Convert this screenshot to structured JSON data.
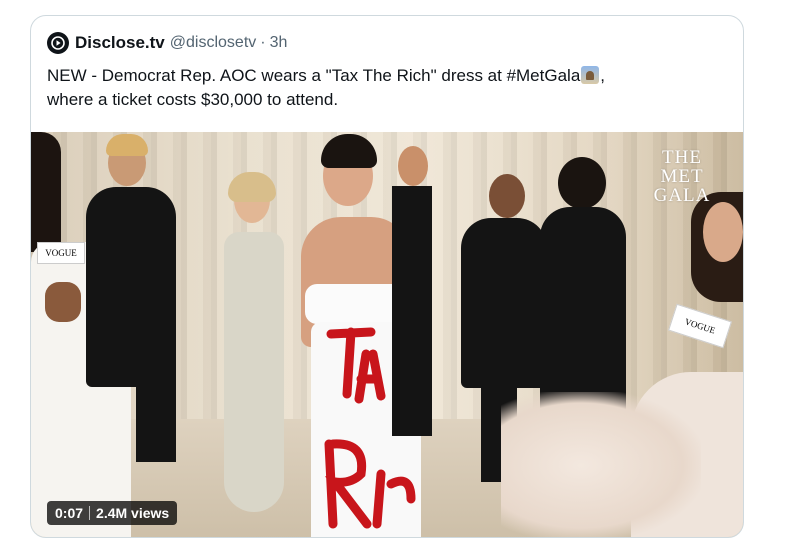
{
  "tweet": {
    "author_name": "Disclose.tv",
    "handle": "@disclosetv",
    "separator": "·",
    "timestamp": "3h",
    "text": "NEW - Democrat Rep. AOC wears a \"Tax The Rich\" dress at #MetGala",
    "text_line2": ",",
    "text_second_line": "where a ticket costs $30,000 to attend.",
    "emoji_icon": "city-scene-emoji"
  },
  "media": {
    "overlay_logo_lines": [
      "THE",
      "MET",
      "GALA"
    ],
    "mic_flag_left": "VOGUE",
    "mic_flag_right": "VOGUE",
    "dress_text": "TAX THE RICH",
    "video_time": "0:07",
    "video_views": "2.4M views"
  },
  "colors": {
    "text_primary": "#0f1419",
    "text_secondary": "#536471",
    "card_border": "#cfd9de",
    "dress_red": "#c8151b"
  }
}
